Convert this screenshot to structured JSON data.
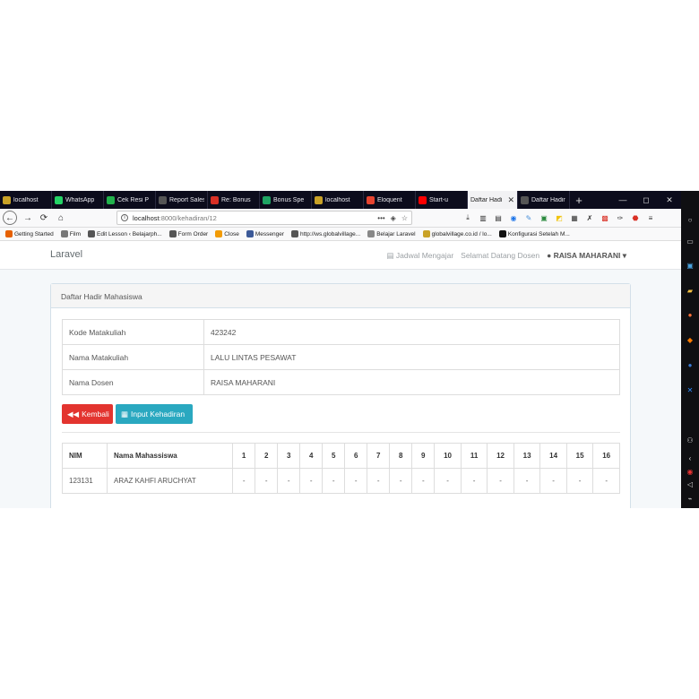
{
  "browser": {
    "tabs": [
      {
        "label": "localhost",
        "color": "#c9a227"
      },
      {
        "label": "WhatsApp",
        "color": "#25d366"
      },
      {
        "label": "Cek Resi P",
        "color": "#22b24c"
      },
      {
        "label": "Report Sales O",
        "color": "#555555"
      },
      {
        "label": "Re: Bonus",
        "color": "#d93025"
      },
      {
        "label": "Bonus Spe",
        "color": "#1fa463"
      },
      {
        "label": "localhost",
        "color": "#c9a227"
      },
      {
        "label": "Eloquent",
        "color": "#e74430"
      },
      {
        "label": "Start-u",
        "color": "#ff0000"
      },
      {
        "label": "Daftar Hadi",
        "color": "#f2f2f4",
        "active": true
      },
      {
        "label": "Daftar Hadir M",
        "color": "#555555"
      }
    ],
    "new_tab": "+",
    "window_buttons": {
      "min": "—",
      "max": "◻",
      "close": "✕"
    },
    "url": {
      "host": "localhost",
      "path": ":8000/kehadiran/12"
    },
    "url_actions": {
      "more": "•••",
      "pocket": "◈",
      "star": "☆"
    },
    "bookmarks": [
      {
        "label": "Getting Started",
        "color": "#e66000"
      },
      {
        "label": "Film",
        "color": "#777777"
      },
      {
        "label": "Edit Lesson ‹ Belajarph...",
        "color": "#555555"
      },
      {
        "label": "Form Order",
        "color": "#555555"
      },
      {
        "label": "Close",
        "color": "#f29b05"
      },
      {
        "label": "Messenger",
        "color": "#3b5998"
      },
      {
        "label": "http://ws.globalvillage...",
        "color": "#555555"
      },
      {
        "label": "Belajar Laravel",
        "color": "#888888"
      },
      {
        "label": "globalvillage.co.id / lo...",
        "color": "#c9a227"
      },
      {
        "label": "Konfigurasi Setelah M...",
        "color": "#111111"
      }
    ]
  },
  "app": {
    "brand": "Laravel",
    "nav_schedule": "Jadwal Mengajar",
    "nav_welcome": "Selamat Datang Dosen",
    "nav_user": "RAISA MAHARANI"
  },
  "panel": {
    "heading": "Daftar Hadir Mahasiswa",
    "info": [
      {
        "label": "Kode Matakuliah",
        "value": "423242"
      },
      {
        "label": "Nama Matakuliah",
        "value": "LALU LINTAS PESAWAT"
      },
      {
        "label": "Nama Dosen",
        "value": "RAISA MAHARANI"
      }
    ],
    "back_label": "Kembali",
    "input_label": "Input Kehadiran"
  },
  "attendance": {
    "col_nim": "NIM",
    "col_name": "Nama Mahassiswa",
    "meetings": [
      "1",
      "2",
      "3",
      "4",
      "5",
      "6",
      "7",
      "8",
      "9",
      "10",
      "11",
      "12",
      "13",
      "14",
      "15",
      "16"
    ],
    "rows": [
      {
        "nim": "123131",
        "name": "ARAZ KAHFI ARUCHYAT",
        "marks": [
          "-",
          "-",
          "-",
          "-",
          "-",
          "-",
          "-",
          "-",
          "-",
          "-",
          "-",
          "-",
          "-",
          "-",
          "-",
          "-"
        ]
      }
    ]
  },
  "colors": {
    "danger": "#e3342f",
    "info": "#2aa8c0",
    "tabbar": "#0c0c1c"
  }
}
